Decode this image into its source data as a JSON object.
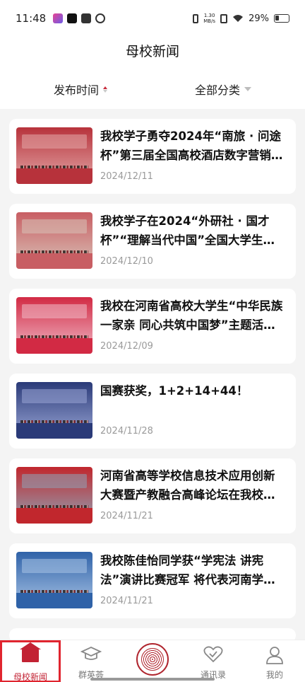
{
  "status_bar": {
    "time": "11:48",
    "net_speed_top": "1.30",
    "net_speed_bottom": "MB/s",
    "battery": "29%"
  },
  "header": {
    "title": "母校新闻",
    "filters": {
      "time_label": "发布时间",
      "category_label": "全部分类"
    }
  },
  "news": [
    {
      "title": "我校学子勇夺2024年“南旅 · 问途杯”第三届全国高校酒店数字营销大赛",
      "date": "2024/12/11",
      "thumb_colors": [
        "#b7323b",
        "#e3a7a7"
      ]
    },
    {
      "title": "我校学子在2024“外研社 · 国才杯”“理解当代中国”全国大学生外语能力大赛中获奖",
      "date": "2024/12/10",
      "thumb_colors": [
        "#c85e63",
        "#d9c3b8"
      ]
    },
    {
      "title": "我校在河南省高校大学生“中华民族一家亲 同心共筑中国梦”主题活动中获奖",
      "date": "2024/12/09",
      "thumb_colors": [
        "#d22a44",
        "#f0b9c7"
      ]
    },
    {
      "title": "国赛获奖，1+2+14+44！",
      "date": "2024/11/28",
      "thumb_colors": [
        "#2a3a78",
        "#9aa6d6"
      ]
    },
    {
      "title": "河南省高等学校信息技术应用创新大赛暨产教融合高峰论坛在我校举行",
      "date": "2024/11/21",
      "thumb_colors": [
        "#c1272d",
        "#8fa3b6"
      ]
    },
    {
      "title": "我校陈佳怡同学获“学宪法 讲宪法”演讲比赛冠军 将代表河南学子参加全国决赛",
      "date": "2024/11/21",
      "thumb_colors": [
        "#2f62a8",
        "#a9c4e6"
      ]
    }
  ],
  "bottom_nav": [
    {
      "label": "母校新闻",
      "icon": "home-icon",
      "active": true
    },
    {
      "label": "群英荟",
      "icon": "graduation-cap-icon",
      "active": false
    },
    {
      "label": "",
      "icon": "school-emblem-icon",
      "active": false
    },
    {
      "label": "通讯录",
      "icon": "heart-contacts-icon",
      "active": false
    },
    {
      "label": "我的",
      "icon": "user-icon",
      "active": false
    }
  ],
  "colors": {
    "accent": "#c22233",
    "active_border": "#e0252f"
  }
}
